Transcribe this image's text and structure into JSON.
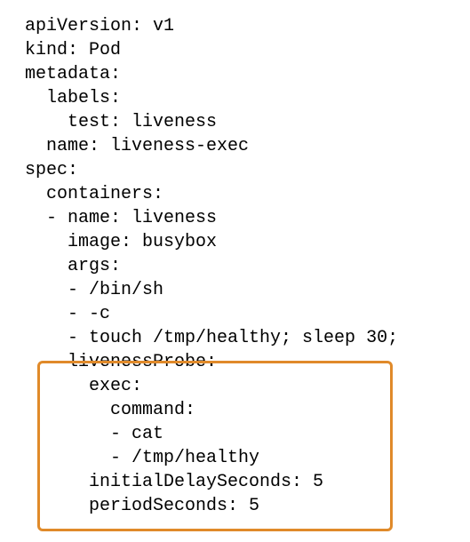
{
  "code": {
    "l1": "apiVersion: v1",
    "l2": "kind: Pod",
    "l3": "metadata:",
    "l4": "  labels:",
    "l5": "    test: liveness",
    "l6": "  name: liveness-exec",
    "l7": "spec:",
    "l8": "  containers:",
    "l9": "  - name: liveness",
    "l10": "    image: busybox",
    "l11": "    args:",
    "l12": "    - /bin/sh",
    "l13": "    - -c",
    "l14": "    - touch /tmp/healthy; sleep 30;",
    "l15": "    livenessProbe:",
    "l16": "      exec:",
    "l17": "        command:",
    "l18": "        - cat",
    "l19": "        - /tmp/healthy",
    "l20": "      initialDelaySeconds: 5",
    "l21": "      periodSeconds: 5"
  },
  "highlight": {
    "color": "#e08a2a"
  }
}
